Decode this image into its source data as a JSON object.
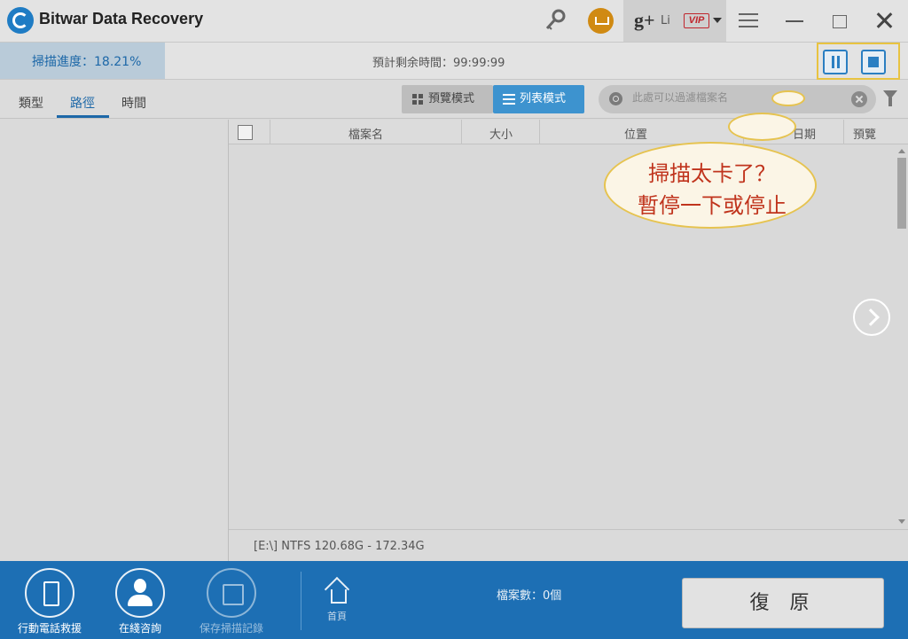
{
  "window": {
    "title": "Bitwar Data Recovery",
    "user_name": "Li",
    "vip_label": "VIP",
    "gplus_label": "g+"
  },
  "scan": {
    "progress_label": "掃描進度：18.21%",
    "progress_percent": 18.21,
    "remaining_label": "預計剩余時間：99:99:99"
  },
  "tabs": {
    "type": "類型",
    "path": "路徑",
    "time": "時間"
  },
  "view_modes": {
    "preview": "預覽模式",
    "list": "列表模式"
  },
  "search": {
    "placeholder": "此處可以過濾檔案名"
  },
  "table": {
    "columns": [
      "檔案名",
      "大小",
      "位置",
      "日期",
      "預覽"
    ]
  },
  "status": {
    "drive_info": "[E:\\] NTFS 120.68G - 172.34G"
  },
  "callout": {
    "line1": "掃描太卡了？",
    "line2": "暫停一下或停止"
  },
  "bottom": {
    "phone_rescue": "行動電話救援",
    "online_consult": "在綫咨詢",
    "save_record": "保存掃描記錄",
    "home": "首頁",
    "file_count": "檔案數：0個",
    "recover": "復 原"
  },
  "colors": {
    "accent": "#1d6fb4",
    "progress_text": "#1d68a8",
    "highlight": "#e8c341",
    "callout_text": "#c0341d"
  }
}
